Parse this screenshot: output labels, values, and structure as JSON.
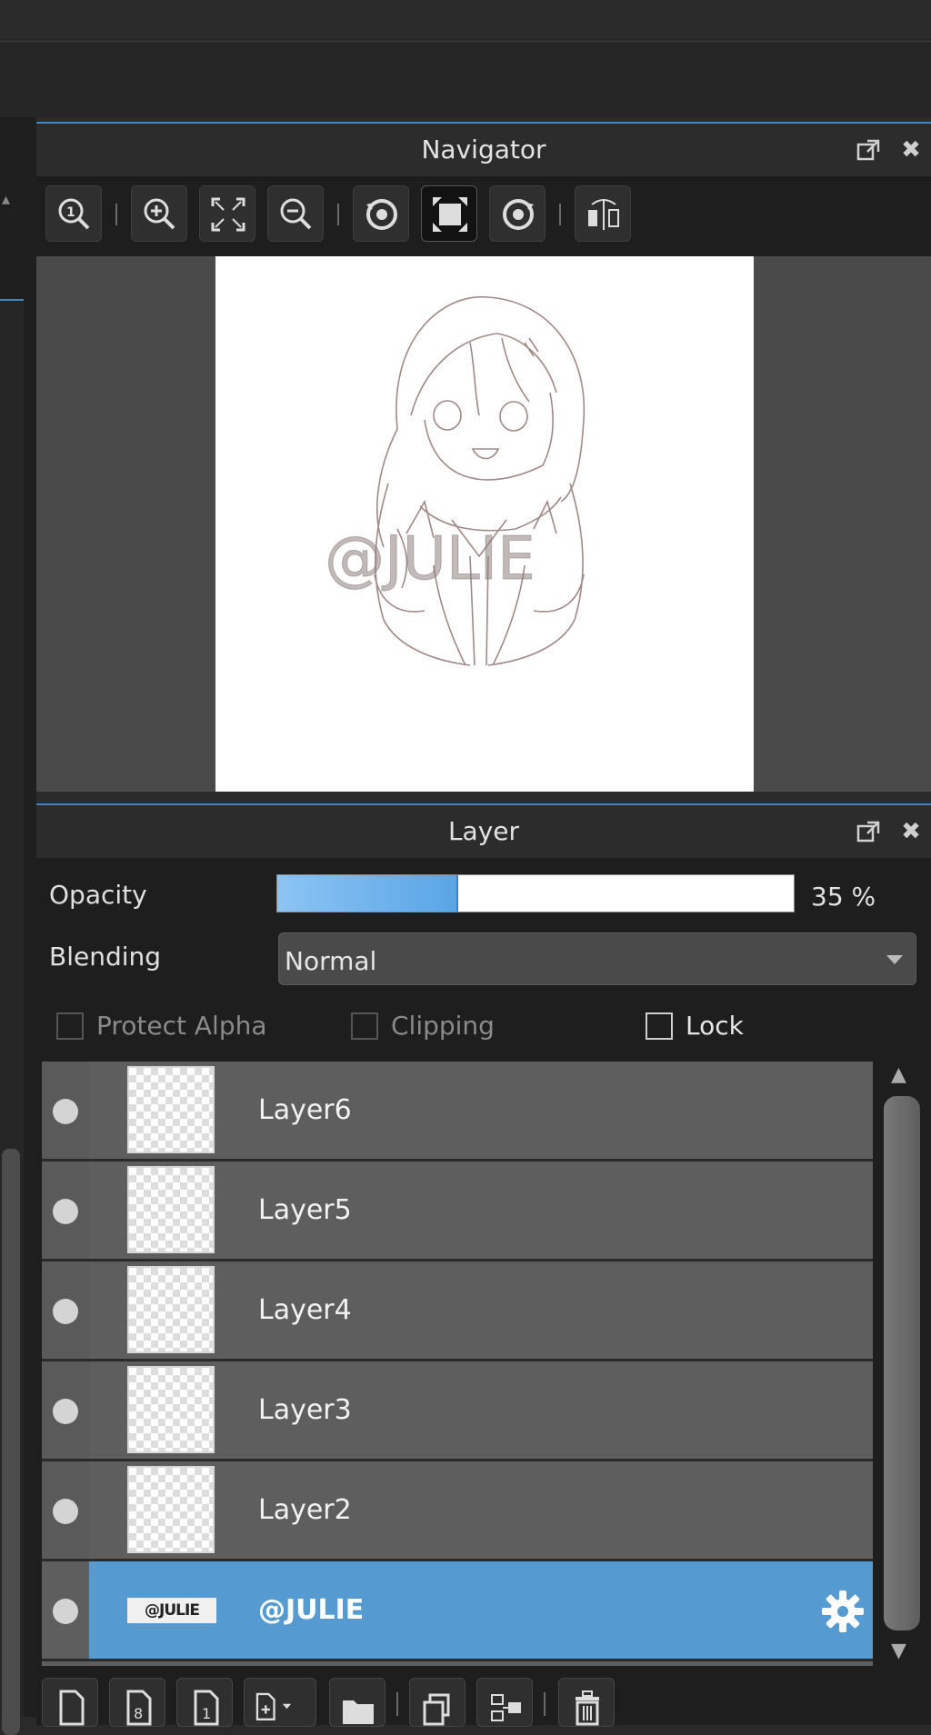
{
  "navigator": {
    "title": "Navigator",
    "preview_watermark": "@JULIE",
    "tools": [
      {
        "icon": "zoom-actual-icon"
      },
      {
        "icon": "zoom-in-icon"
      },
      {
        "icon": "fit-screen-icon"
      },
      {
        "icon": "zoom-out-icon"
      },
      {
        "icon": "rotate-left-icon"
      },
      {
        "icon": "reset-view-icon"
      },
      {
        "icon": "rotate-right-icon"
      },
      {
        "icon": "flip-horizontal-icon"
      }
    ]
  },
  "layer": {
    "title": "Layer",
    "opacity_label": "Opacity",
    "opacity_value": "35 %",
    "opacity_fraction": 0.35,
    "blending_label": "Blending",
    "blending_value": "Normal",
    "protect_alpha_label": "Protect Alpha",
    "clipping_label": "Clipping",
    "lock_label": "Lock",
    "layers": [
      {
        "name": "Layer6"
      },
      {
        "name": "Layer5"
      },
      {
        "name": "Layer4"
      },
      {
        "name": "Layer3"
      },
      {
        "name": "Layer2"
      },
      {
        "name": "@JULIE",
        "thumb_text": "@JULIE",
        "selected": true
      }
    ]
  },
  "colors": {
    "accent": "#559bd2",
    "panel_bg": "#1e1e1e",
    "row_bg": "#5e5e5e"
  }
}
